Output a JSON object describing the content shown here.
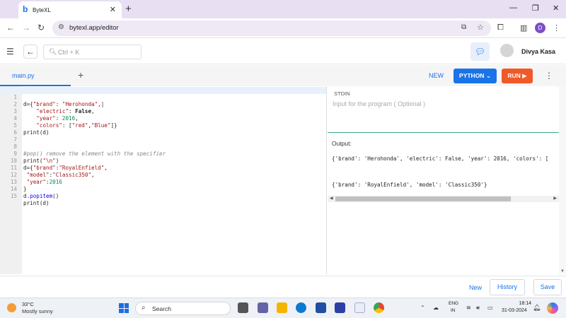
{
  "browser": {
    "tab_title": "ByteXL",
    "favicon": "b",
    "url": "bytexl.app/editor",
    "profile_initial": "D"
  },
  "header": {
    "search_placeholder": "Ctrl + K",
    "username": "Divya Kasa"
  },
  "toolbar": {
    "file_tab": "main.py",
    "new_label": "NEW",
    "language_label": "PYTHON",
    "run_label": "RUN"
  },
  "editor": {
    "line_numbers": [
      "1",
      "2",
      "3",
      "4",
      "5",
      "6",
      "7",
      "8",
      "9",
      "10",
      "11",
      "12",
      "13",
      "14",
      "15"
    ]
  },
  "stdin": {
    "label": "STDIN",
    "placeholder": "Input for the program ( Optional )"
  },
  "output": {
    "label": "Output:",
    "lines": [
      "{'brand': 'Herohonda', 'electric': False, 'year': 2016, 'colors': [",
      "",
      "",
      "",
      "{'brand': 'RoyalEnfield', 'model': 'Classic350'}"
    ]
  },
  "bottom": {
    "new_label": "New",
    "history_label": "History",
    "save_label": "Save"
  },
  "taskbar": {
    "temperature": "33°C",
    "condition": "Mostly sunny",
    "search_label": "Search",
    "lang_line1": "ENG",
    "lang_line2": "IN",
    "time": "18:14",
    "date": "31-03-2024"
  },
  "colors": {
    "accent": "#1a73e8",
    "run": "#f05a28",
    "stdin_border": "#3aa78a"
  }
}
